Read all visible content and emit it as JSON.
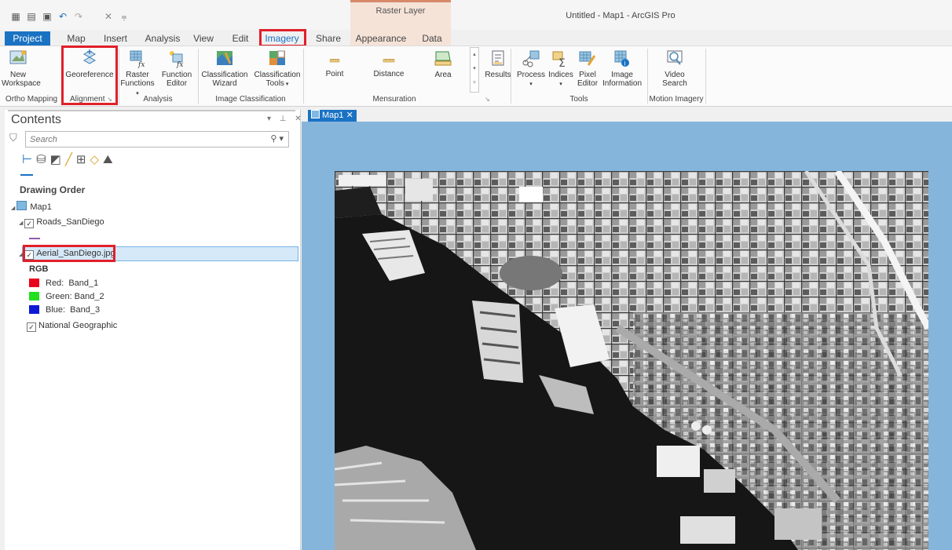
{
  "window": {
    "title": "Untitled - Map1 - ArcGIS Pro",
    "contextual_tab_title": "Raster Layer"
  },
  "qat_icons": [
    "new-project-icon",
    "open-project-icon",
    "save-project-icon",
    "undo-icon",
    "redo-icon",
    "close-icon",
    "customize-icon"
  ],
  "tabs": [
    "Project",
    "Map",
    "Insert",
    "Analysis",
    "View",
    "Edit",
    "Imagery",
    "Share",
    "Appearance",
    "Data"
  ],
  "active_tab": "Imagery",
  "ribbon": {
    "new_workspace": "New\nWorkspace",
    "georeference": "Georeference",
    "raster_functions": "Raster\nFunctions",
    "function_editor": "Function\nEditor",
    "classification_wizard": "Classification\nWizard",
    "classification_tools": "Classification\nTools",
    "point": "Point",
    "distance": "Distance",
    "area": "Area",
    "results": "Results",
    "process": "Process",
    "indices": "Indices",
    "pixel_editor": "Pixel\nEditor",
    "image_information": "Image\nInformation",
    "video_search": "Video\nSearch",
    "groups": {
      "ortho_mapping": "Ortho Mapping",
      "alignment": "Alignment",
      "analysis": "Analysis",
      "image_classification": "Image Classification",
      "mensuration": "Mensuration",
      "tools": "Tools",
      "motion_imagery": "Motion Imagery"
    }
  },
  "contents": {
    "title": "Contents",
    "search_placeholder": "Search",
    "drawing_order": "Drawing Order",
    "map_name": "Map1",
    "layers": {
      "roads": "Roads_SanDiego",
      "aerial": "Aerial_SanDiego.jpg",
      "rgb_label": "RGB",
      "red": "Red:  Band_1",
      "green": "Green: Band_2",
      "blue": "Blue:  Band_3",
      "basemap": "National Geographic"
    },
    "colors": {
      "red": "#e8001c",
      "green": "#22e01e",
      "blue": "#0c1ad6",
      "roads_line": "#8e5bb0"
    }
  },
  "map_tab": "Map1",
  "colors": {
    "accent": "#1a72c3",
    "highlight": "#e0202a",
    "map_background": "#86b5dc",
    "contextual": "#f5e3d8"
  }
}
